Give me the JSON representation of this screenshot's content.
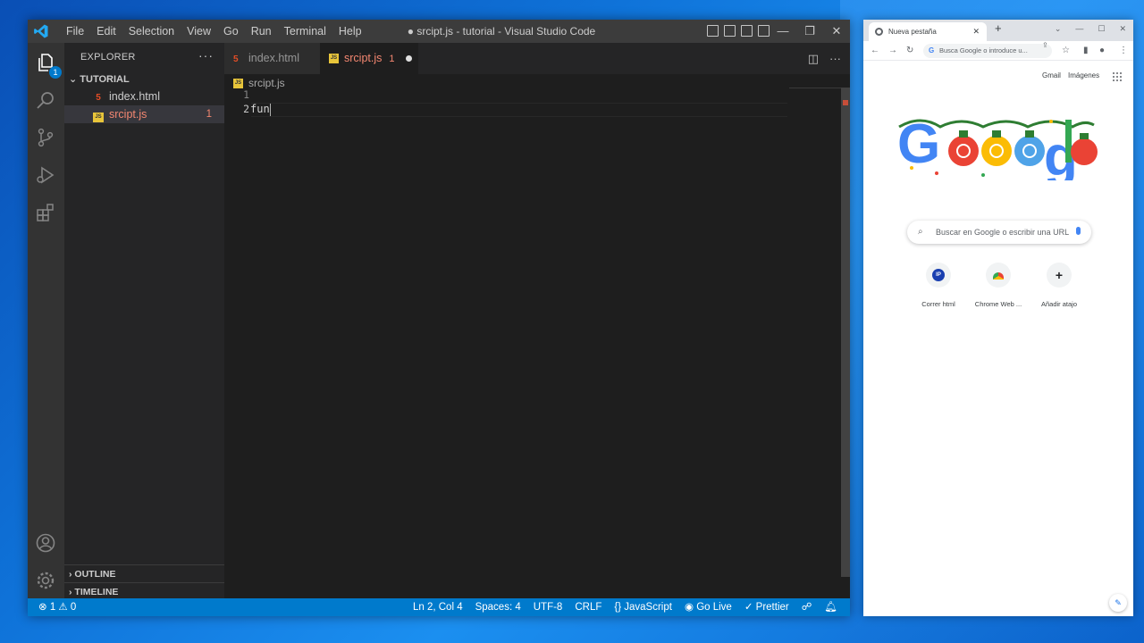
{
  "vscode": {
    "menu": [
      "File",
      "Edit",
      "Selection",
      "View",
      "Go",
      "Run",
      "Terminal",
      "Help"
    ],
    "window_title": "● srcipt.js - tutorial - Visual Studio Code",
    "win_controls": {
      "minimize": "—",
      "restore": "❐",
      "close": "✕"
    },
    "activity_badge": "1",
    "explorer": {
      "header": "EXPLORER",
      "more": "···",
      "folder": "TUTORIAL",
      "files": [
        {
          "name": "index.html",
          "icon": "html5-icon"
        },
        {
          "name": "srcipt.js",
          "icon": "js-icon",
          "problems": "1"
        }
      ],
      "sections": [
        "OUTLINE",
        "TIMELINE"
      ]
    },
    "tabs": [
      {
        "label": "index.html"
      },
      {
        "label": "srcipt.js",
        "problems": "1"
      }
    ],
    "breadcrumb": "srcipt.js",
    "line_numbers": [
      "1",
      "2"
    ],
    "code_line_2": "fun",
    "status": {
      "problems": "⊗ 1 ⚠ 0",
      "position": "Ln 2, Col 4",
      "spaces": "Spaces: 4",
      "encoding": "UTF-8",
      "eol": "CRLF",
      "language": "{} JavaScript",
      "golive": "Go Live",
      "prettier": "✓ Prettier"
    }
  },
  "chrome": {
    "tab_title": "Nueva pestaña",
    "omnibox_placeholder": "Busca Google o introduce u...",
    "gmail": "Gmail",
    "images": "Imágenes",
    "search_placeholder": "Buscar en Google o escribir una URL",
    "shortcuts": [
      {
        "label": "Correr html",
        "initial": "IP"
      },
      {
        "label": "Chrome Web ...",
        "initial": ""
      },
      {
        "label": "Añadir atajo",
        "initial": "+"
      }
    ]
  },
  "colors": {
    "vscode_accent": "#007acc",
    "error": "#f48771",
    "google_blue": "#4285f4",
    "google_red": "#ea4335",
    "google_yellow": "#fbbc05",
    "google_green": "#34a853"
  }
}
